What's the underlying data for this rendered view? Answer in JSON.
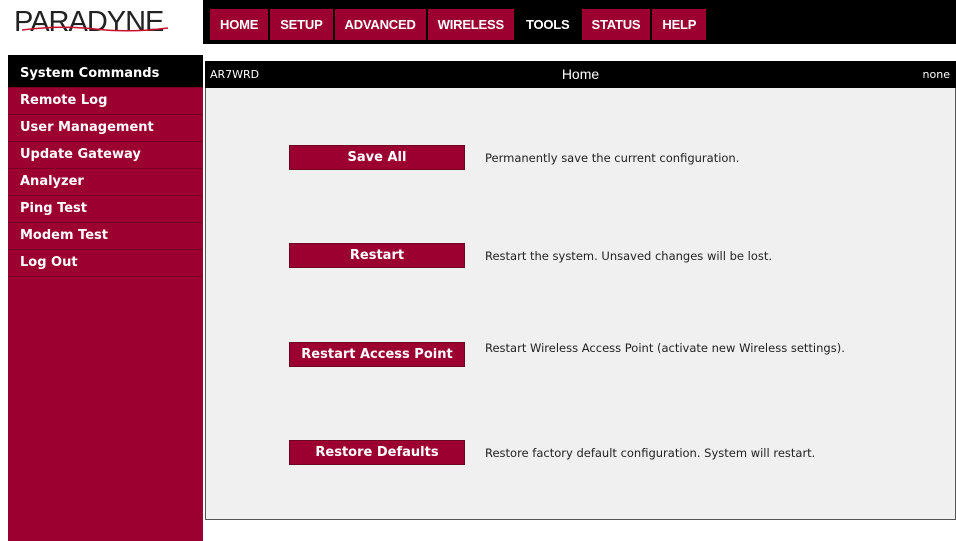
{
  "brand": {
    "logo_text": "PARADYNE"
  },
  "topnav": {
    "tabs": [
      {
        "label": "HOME",
        "active": false
      },
      {
        "label": "SETUP",
        "active": false
      },
      {
        "label": "ADVANCED",
        "active": false
      },
      {
        "label": "WIRELESS",
        "active": false
      },
      {
        "label": "TOOLS",
        "active": true
      },
      {
        "label": "STATUS",
        "active": false
      },
      {
        "label": "HELP",
        "active": false
      }
    ]
  },
  "sidebar": {
    "items": [
      {
        "label": "System Commands",
        "active": true
      },
      {
        "label": "Remote Log",
        "active": false
      },
      {
        "label": "User Management",
        "active": false
      },
      {
        "label": "Update Gateway",
        "active": false
      },
      {
        "label": "Analyzer",
        "active": false
      },
      {
        "label": "Ping Test",
        "active": false
      },
      {
        "label": "Modem Test",
        "active": false
      },
      {
        "label": "Log Out",
        "active": false
      }
    ]
  },
  "content_bar": {
    "model": "AR7WRD",
    "title": "Home",
    "user": "none"
  },
  "commands": [
    {
      "button": "Save All",
      "description": "Permanently save the current configuration."
    },
    {
      "button": "Restart",
      "description": "Restart the system. Unsaved changes will be lost."
    },
    {
      "button": "Restart Access Point",
      "description": "Restart Wireless Access Point (activate new Wireless settings)."
    },
    {
      "button": "Restore Defaults",
      "description": "Restore factory default configuration. System will restart."
    }
  ],
  "colors": {
    "accent": "#9b0030",
    "bar": "#000000",
    "panel": "#f0f0f0"
  }
}
